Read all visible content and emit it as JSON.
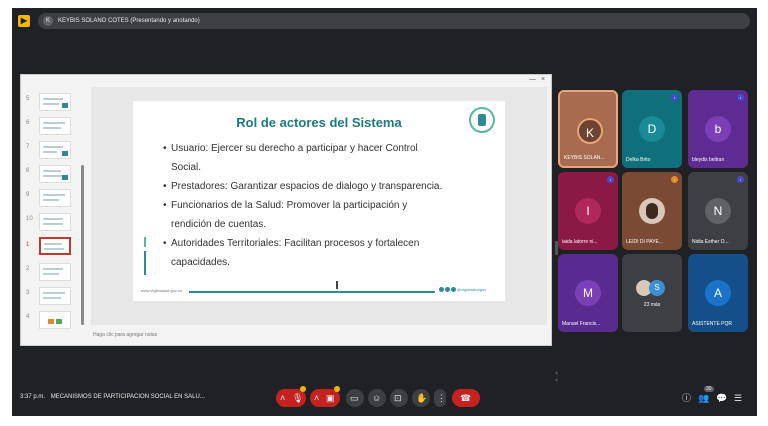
{
  "topbar": {
    "app_icon": "presentation-icon",
    "presenter_initial": "K",
    "presenting_text": "KEYBIS SOLANO COTES (Presentando y anotando)"
  },
  "window": {
    "minimize": "—",
    "close": "×"
  },
  "thumbs": [
    {
      "n": "5"
    },
    {
      "n": "6"
    },
    {
      "n": "7"
    },
    {
      "n": "8"
    },
    {
      "n": "9"
    },
    {
      "n": "10"
    },
    {
      "n": "1"
    },
    {
      "n": "2"
    },
    {
      "n": "3"
    },
    {
      "n": "4"
    }
  ],
  "slide": {
    "title": "Rol de actores del Sistema",
    "bullets": [
      "Usuario: Ejercer su derecho a participar y hacer Control",
      "Social.",
      "Prestadores: Garantizar espacios de dialogo y transparencia.",
      "Funcionarios de la Salud: Promover la participación y",
      "rendición de cuentas.",
      "Autoridades Territoriales: Facilitan procesos y fortalecen",
      "capacidades."
    ],
    "footer_left": "www.vigilesalud.gov.co",
    "footer_right": "@vigilesaludgov"
  },
  "notes_placeholder": "Haga clic para agregar notas",
  "participants": [
    {
      "initial": "K",
      "name": "KEYBIS SOLAN...",
      "color": "#a86b4f"
    },
    {
      "initial": "D",
      "name": "Delka Brito",
      "color": "#1a8a96"
    },
    {
      "initial": "b",
      "name": "bleydis beltran",
      "color": "#7b3fb8"
    },
    {
      "initial": "I",
      "name": "iaida latorre ni...",
      "color": "#b0285a"
    },
    {
      "initial": "",
      "name": "LEIDI DI PAYE...",
      "color": "#d9c7b8"
    },
    {
      "initial": "N",
      "name": "Nidia Esther O...",
      "color": "#5f6368"
    },
    {
      "initial": "M",
      "name": "Manuel Francis...",
      "color": "#7b3fb8"
    },
    {
      "initial": "S",
      "name": "23 más",
      "color": "#3b8ed8"
    },
    {
      "initial": "A",
      "name": "ASISTENTE PQR",
      "color": "#1a73c9"
    }
  ],
  "bottom": {
    "time": "3:37 p.m.",
    "meeting_name": "MECANISMOS DE PARTICIPACION SOCIAL EN SALU...",
    "controls": [
      "chevron-up-icon",
      "microphone-off-icon",
      "chevron-up-icon",
      "camera-off-icon",
      "captions-icon",
      "emoji-icon",
      "present-icon",
      "raise-hand-icon",
      "more-icon",
      "end-call-icon"
    ],
    "right_controls": [
      "info-icon",
      "people-icon",
      "chat-icon",
      "activities-icon"
    ],
    "people_count": "30"
  }
}
